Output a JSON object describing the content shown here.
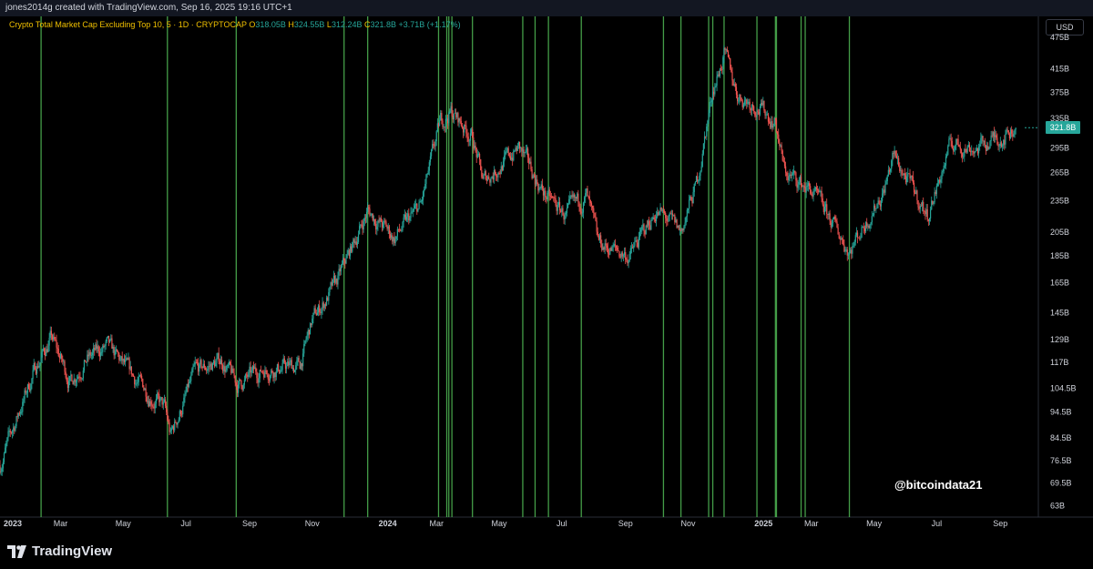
{
  "header": {
    "byline": "jones2014g created with TradingView.com, Sep 16, 2025 19:16 UTC+1"
  },
  "legend": {
    "symbol": "Crypto Total Market Cap Excluding Top 10, 5 · 1D · CRYPTOCAP",
    "o_label": "O",
    "o_value": "318.05B",
    "h_label": "H",
    "h_value": "324.55B",
    "l_label": "L",
    "l_value": "312.24B",
    "c_label": "C",
    "c_value": "321.8B",
    "change": "+3.71B (+1.17%)"
  },
  "currency": "USD",
  "watermark": "@bitcoindata21",
  "brand": "TradingView",
  "colors": {
    "up": "#26a69a",
    "down": "#ef5350",
    "vline": "#4caf50",
    "background": "#000000",
    "axis_text": "#d1d4dc",
    "last_price_tag": "#26a69a"
  },
  "chart_data": {
    "type": "candlestick",
    "title": "Crypto Total Market Cap Excluding Top 10",
    "y_scale": "log",
    "ylim": [
      60,
      520
    ],
    "x_range": [
      "2023-01-01",
      "2025-10-08"
    ],
    "last_price": 321.8,
    "last_price_label": "321.8B",
    "y_ticks": [
      {
        "value": 475,
        "label": "475B"
      },
      {
        "value": 415,
        "label": "415B"
      },
      {
        "value": 375,
        "label": "375B"
      },
      {
        "value": 335,
        "label": "335B"
      },
      {
        "value": 295,
        "label": "295B"
      },
      {
        "value": 265,
        "label": "265B"
      },
      {
        "value": 235,
        "label": "235B"
      },
      {
        "value": 205,
        "label": "205B"
      },
      {
        "value": 185,
        "label": "185B"
      },
      {
        "value": 165,
        "label": "165B"
      },
      {
        "value": 145,
        "label": "145B"
      },
      {
        "value": 129,
        "label": "129B"
      },
      {
        "value": 117,
        "label": "117B"
      },
      {
        "value": 104.5,
        "label": "104.5B"
      },
      {
        "value": 94.5,
        "label": "94.5B"
      },
      {
        "value": 84.5,
        "label": "84.5B"
      },
      {
        "value": 76.5,
        "label": "76.5B"
      },
      {
        "value": 69.5,
        "label": "69.5B"
      },
      {
        "value": 63,
        "label": "63B"
      }
    ],
    "x_ticks": [
      {
        "date": "2023-01-01",
        "label": "2023",
        "bold": true
      },
      {
        "date": "2023-03-01",
        "label": "Mar"
      },
      {
        "date": "2023-05-01",
        "label": "May"
      },
      {
        "date": "2023-07-01",
        "label": "Jul"
      },
      {
        "date": "2023-09-01",
        "label": "Sep"
      },
      {
        "date": "2023-11-01",
        "label": "Nov"
      },
      {
        "date": "2024-01-01",
        "label": "2024",
        "bold": true
      },
      {
        "date": "2024-03-01",
        "label": "Mar"
      },
      {
        "date": "2024-05-01",
        "label": "May"
      },
      {
        "date": "2024-07-01",
        "label": "Jul"
      },
      {
        "date": "2024-09-01",
        "label": "Sep"
      },
      {
        "date": "2024-11-01",
        "label": "Nov"
      },
      {
        "date": "2025-01-01",
        "label": "2025",
        "bold": true
      },
      {
        "date": "2025-03-01",
        "label": "Mar"
      },
      {
        "date": "2025-05-01",
        "label": "May"
      },
      {
        "date": "2025-07-01",
        "label": "Jul"
      },
      {
        "date": "2025-09-01",
        "label": "Sep"
      }
    ],
    "price_path": [
      [
        "2023-01-01",
        75
      ],
      [
        "2023-01-20",
        95
      ],
      [
        "2023-02-05",
        115
      ],
      [
        "2023-02-20",
        130
      ],
      [
        "2023-03-10",
        108
      ],
      [
        "2023-03-25",
        118
      ],
      [
        "2023-04-15",
        125
      ],
      [
        "2023-05-10",
        110
      ],
      [
        "2023-06-10",
        96
      ],
      [
        "2023-06-16",
        85
      ],
      [
        "2023-07-10",
        112
      ],
      [
        "2023-08-05",
        118
      ],
      [
        "2023-08-20",
        106
      ],
      [
        "2023-09-15",
        114
      ],
      [
        "2023-10-20",
        115
      ],
      [
        "2023-11-01",
        140
      ],
      [
        "2023-11-25",
        165
      ],
      [
        "2023-12-25",
        225
      ],
      [
        "2024-01-20",
        200
      ],
      [
        "2024-02-15",
        230
      ],
      [
        "2024-03-05",
        330
      ],
      [
        "2024-03-15",
        345
      ],
      [
        "2024-04-05",
        310
      ],
      [
        "2024-04-15",
        255
      ],
      [
        "2024-05-20",
        295
      ],
      [
        "2024-06-15",
        240
      ],
      [
        "2024-07-05",
        220
      ],
      [
        "2024-07-25",
        240
      ],
      [
        "2024-08-05",
        195
      ],
      [
        "2024-09-05",
        185
      ],
      [
        "2024-10-01",
        225
      ],
      [
        "2024-10-25",
        205
      ],
      [
        "2024-11-10",
        255
      ],
      [
        "2024-11-25",
        380
      ],
      [
        "2024-12-06",
        440
      ],
      [
        "2024-12-20",
        370
      ],
      [
        "2025-01-07",
        355
      ],
      [
        "2025-01-25",
        330
      ],
      [
        "2025-02-03",
        265
      ],
      [
        "2025-03-01",
        245
      ],
      [
        "2025-04-07",
        190
      ],
      [
        "2025-05-10",
        245
      ],
      [
        "2025-05-20",
        285
      ],
      [
        "2025-06-22",
        220
      ],
      [
        "2025-07-15",
        300
      ],
      [
        "2025-08-10",
        295
      ],
      [
        "2025-09-16",
        321.8
      ]
    ],
    "vertical_markers": [
      "2023-02-10",
      "2023-06-13",
      "2023-08-19",
      "2023-12-02",
      "2023-12-25",
      "2024-03-03",
      "2024-03-11",
      "2024-03-13",
      "2024-03-16",
      "2024-04-05",
      "2024-05-24",
      "2024-06-05",
      "2024-06-18",
      "2024-07-20",
      "2024-10-08",
      "2024-10-25",
      "2024-11-21",
      "2024-11-25",
      "2024-12-06",
      "2025-01-07",
      "2025-01-25",
      "2025-01-26",
      "2025-02-19",
      "2025-02-23",
      "2025-04-07"
    ]
  }
}
